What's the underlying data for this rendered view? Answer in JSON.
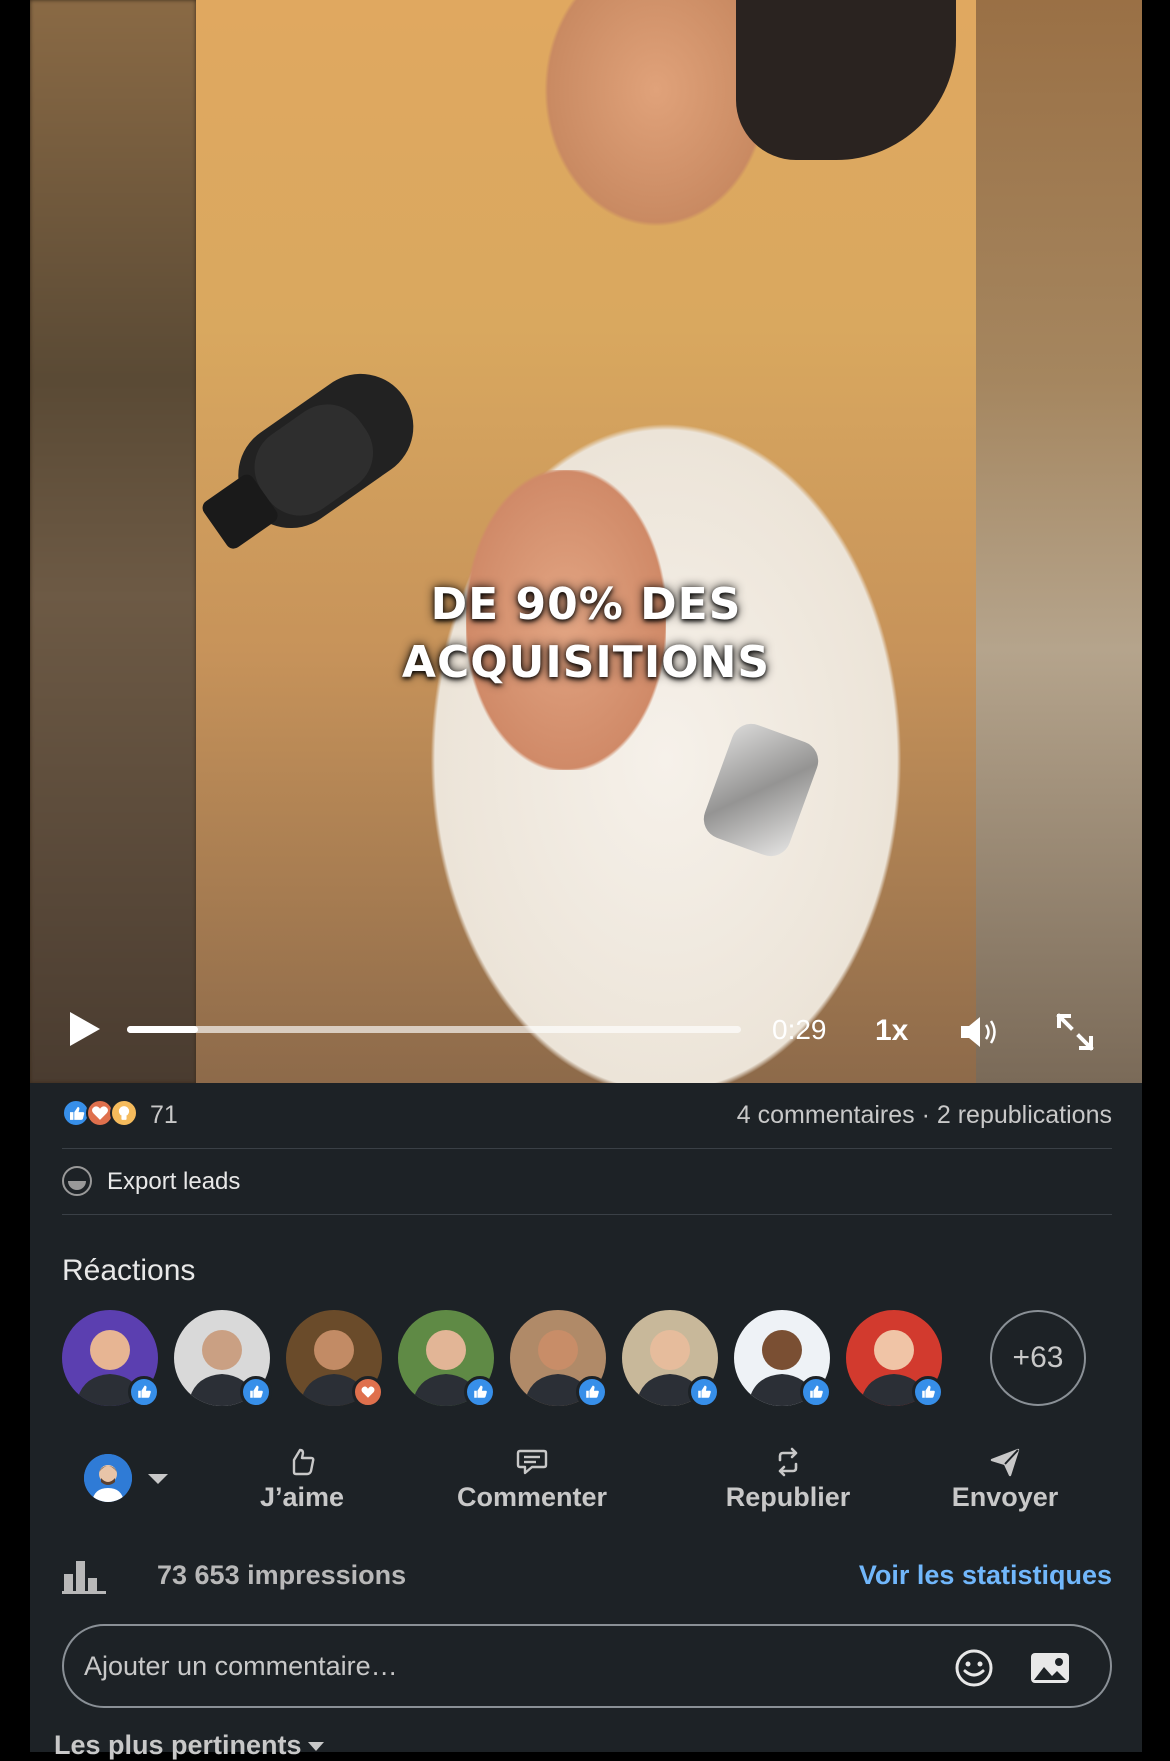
{
  "video": {
    "caption_line1": "DE 90% DES",
    "caption_line2": "ACQUISITIONS",
    "time": "0:29",
    "speed": "1x",
    "progress_fraction": 0.115
  },
  "social": {
    "reaction_icons": [
      "like-icon",
      "love-icon",
      "insightful-icon"
    ],
    "reaction_count": "71",
    "comments": "4 commentaires",
    "separator": " · ",
    "reposts": "2 republications"
  },
  "export": {
    "label": "Export leads"
  },
  "reactions": {
    "title": "Réactions",
    "more": "+63",
    "avatars": [
      {
        "badge": "like",
        "bg": "#5b3fb0",
        "skin": "#e7b593"
      },
      {
        "badge": "like",
        "bg": "#d9d9d9",
        "skin": "#caa083"
      },
      {
        "badge": "love",
        "bg": "#6a4b2a",
        "skin": "#c28b65"
      },
      {
        "badge": "like",
        "bg": "#5f8a45",
        "skin": "#e2b596"
      },
      {
        "badge": "like",
        "bg": "#b08a68",
        "skin": "#c88d68"
      },
      {
        "badge": "like",
        "bg": "#c8b89a",
        "skin": "#e6bc9c"
      },
      {
        "badge": "like",
        "bg": "#eef2f6",
        "skin": "#7a4f33"
      },
      {
        "badge": "like",
        "bg": "#d23a2e",
        "skin": "#f0c4a6"
      }
    ]
  },
  "actions": {
    "like": "J’aime",
    "comment": "Commenter",
    "repost": "Republier",
    "send": "Envoyer"
  },
  "impressions": {
    "text": "73 653 impressions",
    "link": "Voir les statistiques"
  },
  "comment": {
    "placeholder": "Ajouter un commentaire…"
  },
  "sort": {
    "label": "Les plus pertinents"
  },
  "colors": {
    "background": "#1d2226",
    "link": "#71b7fb",
    "like_badge": "#378fe9",
    "love_badge": "#df704d"
  }
}
